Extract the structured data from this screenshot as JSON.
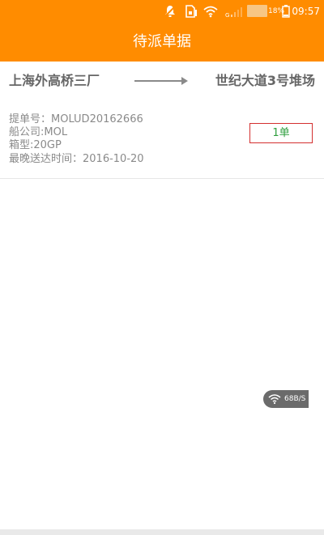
{
  "status_bar": {
    "time": "09:57",
    "battery_percent": "18%",
    "icons": [
      "notification-off-icon",
      "sim-card-icon",
      "wifi-icon",
      "cellular-signal-icon",
      "battery-icon"
    ]
  },
  "app_bar": {
    "title": "待派单据"
  },
  "orders": [
    {
      "origin": "上海外高桥三厂",
      "destination": "世纪大道3号堆场",
      "bill_no": "提单号：MOLUD20162666",
      "shipping_company": "船公司:MOL",
      "container_type": "箱型:20GP",
      "deadline": "最晚送达时间：2016-10-20",
      "count": "1单"
    }
  ],
  "network_speed": "68B/S",
  "colors": {
    "primary": "#ff8c00",
    "badge_border": "#d32f2f",
    "badge_text": "#2e9e3e",
    "text_secondary": "#8a8a8a"
  }
}
